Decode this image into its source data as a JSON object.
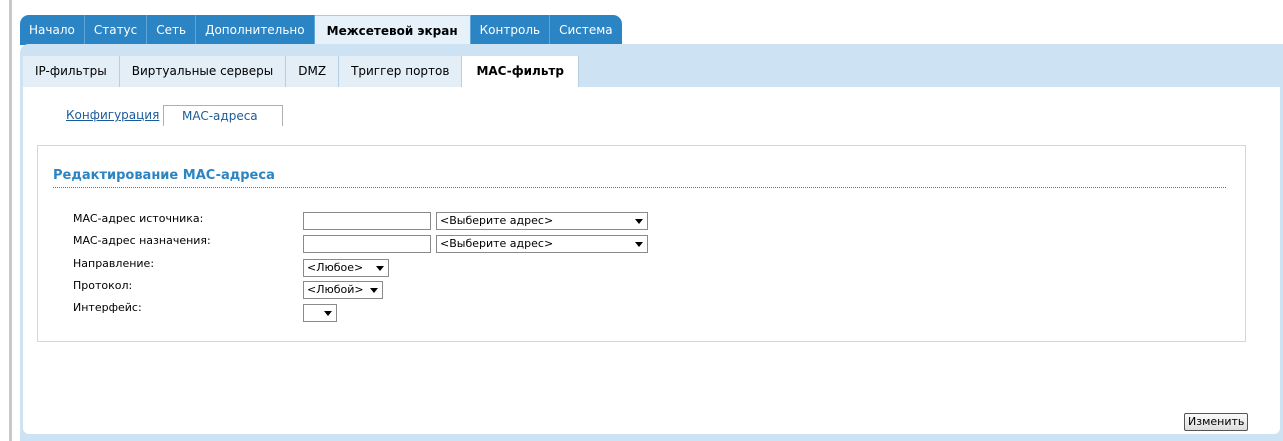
{
  "top_tabs": [
    "Начало",
    "Статус",
    "Сеть",
    "Дополнительно",
    "Межсетевой экран",
    "Контроль",
    "Система"
  ],
  "sub_tabs": [
    "IP-фильтры",
    "Виртуальные серверы",
    "DMZ",
    "Триггер портов",
    "MAC-фильтр"
  ],
  "inner_tabs": [
    "Конфигурация",
    "MAC-адреса"
  ],
  "section_title": "Редактирование MAC-адреса",
  "form": {
    "src_mac_label": "MAC-адрес источника:",
    "src_mac_value": "",
    "src_mac_select": "<Выберите адрес>",
    "dst_mac_label": "MAC-адрес назначения:",
    "dst_mac_value": "",
    "dst_mac_select": "<Выберите адрес>",
    "direction_label": "Направление:",
    "direction_value": "<Любое>",
    "protocol_label": "Протокол:",
    "protocol_value": "<Любой>",
    "interface_label": "Интерфейс:",
    "interface_value": ""
  },
  "change_button": "Изменить"
}
